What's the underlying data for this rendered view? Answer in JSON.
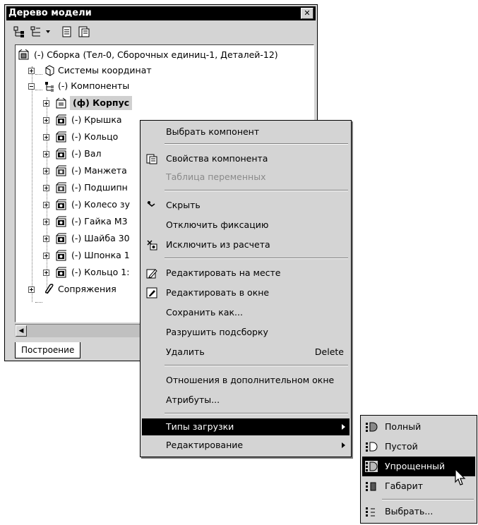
{
  "window": {
    "title": "Дерево модели",
    "close_glyph": "✕",
    "tab_label": "Построение"
  },
  "tree": {
    "root": "(-) Сборка (Тел-0, Сборочных единиц-1, Деталей-12)",
    "coord_systems": "Системы координат",
    "components_group": "(-) Компоненты",
    "components": [
      "(ф) Корпус",
      "(-) Крышка",
      "(-) Кольцо",
      "(-) Вал",
      "(-) Манжета",
      "(-) Подшипн",
      "(-) Колесо зу",
      "(-) Гайка М3",
      "(-) Шайба 30",
      "(-) Шпонка 1",
      "(-) Кольцо 1:"
    ],
    "mates": "Сопряжения"
  },
  "context_menu": {
    "select_component": "Выбрать компонент",
    "component_properties": "Свойства компонента",
    "variables_table": "Таблица переменных",
    "hide": "Скрыть",
    "unfix": "Отключить фиксацию",
    "exclude_from_calc": "Исключить из расчета",
    "edit_in_place": "Редактировать на месте",
    "edit_in_window": "Редактировать в окне",
    "save_as": "Сохранить как...",
    "break_selection": "Разрушить подсборку",
    "delete": "Удалить",
    "delete_shortcut": "Delete",
    "relations_window": "Отношения в дополнительном окне",
    "attributes": "Атрибуты...",
    "load_types": "Типы загрузки",
    "editing": "Редактирование"
  },
  "submenu": {
    "full": "Полный",
    "empty": "Пустой",
    "simplified": "Упрощенный",
    "bounding": "Габарит",
    "choose": "Выбрать..."
  },
  "colors": {
    "highlight": "#000000",
    "menu_bg": "#d4d4d4",
    "disabled": "#8a8a8a"
  }
}
